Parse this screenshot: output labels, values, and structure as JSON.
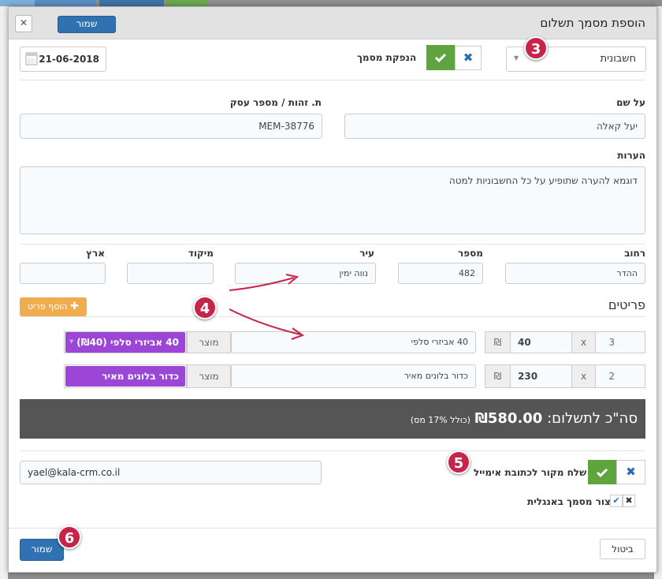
{
  "modal": {
    "title": "הוספת מסמך תשלום",
    "header_save": "שמור",
    "close_glyph": "✕"
  },
  "doc": {
    "type_value": "חשבונית",
    "issue_label": "הנפקת מסמך",
    "date_value": "21-06-2018"
  },
  "customer": {
    "name_label": "על שם",
    "name_value": "יעל קאלה",
    "id_label": "ת. זהות / מספר עסק",
    "id_value": "MEM-38776",
    "notes_label": "הערות",
    "notes_value": "דוגמא להערה שתופיע על כל החשבוניות למטה"
  },
  "address": {
    "street_label": "רחוב",
    "street_value": "ההדר",
    "number_label": "מספר",
    "number_value": "482",
    "city_label": "עיר",
    "city_value": "נווה ימין",
    "zip_label": "מיקוד",
    "zip_value": "",
    "country_label": "ארץ",
    "country_value": ""
  },
  "items": {
    "title": "פריטים",
    "add_label": "הוסף פריט",
    "product_label": "מוצר",
    "currency": "₪",
    "times": "x",
    "rows": [
      {
        "qty": "3",
        "price": "40",
        "desc": "40 אביזרי סלפי",
        "product": "40 אביזרי סלפי (₪40)"
      },
      {
        "qty": "2",
        "price": "230",
        "desc": "כדור בלונים מאיר",
        "product": "כדור בלונים מאיר (₪230)"
      }
    ]
  },
  "total": {
    "label": "סה\"כ לתשלום:",
    "amount": "₪580.00",
    "vat_note": "(כולל 17% מס)"
  },
  "email": {
    "send_label": "שלח מקור לכתובת אימייל",
    "value": "yael@kala-crm.co.il",
    "english_label": "צור מסמך באנגלית"
  },
  "footer": {
    "save": "שמור",
    "cancel": "ביטול"
  },
  "badges": {
    "b3": "3",
    "b4": "4",
    "b5": "5",
    "b6": "6"
  },
  "colors": {
    "primary": "#2f71b1",
    "success": "#5fa43f",
    "purple": "#9b46d6",
    "orange": "#f0ad4e",
    "badge": "#c6254a"
  }
}
